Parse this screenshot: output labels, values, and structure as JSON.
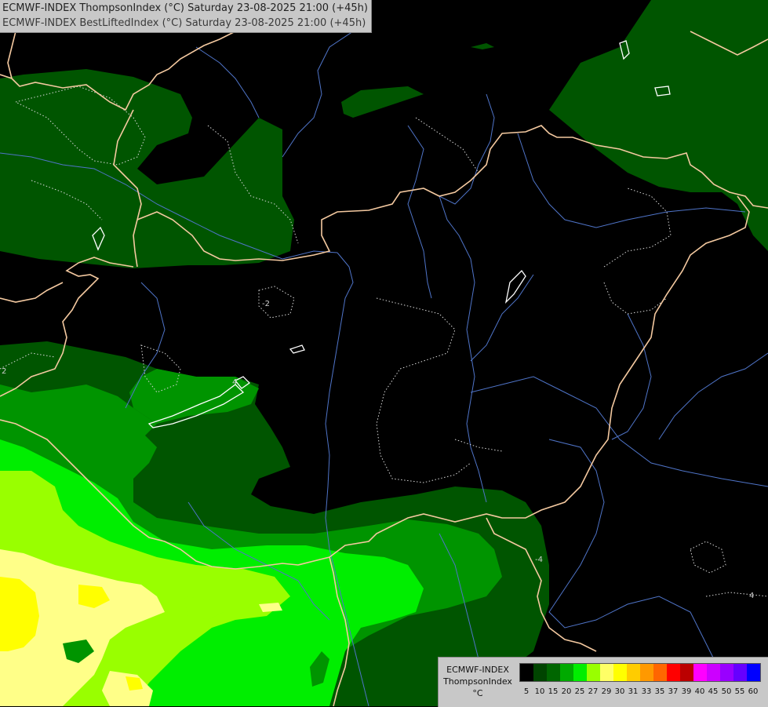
{
  "titles": {
    "line1": "ECMWF-INDEX ThompsonIndex (°C) Saturday 23-08-2025 21:00 (+45h)",
    "line2": "ECMWF-INDEX BestLiftedIndex (°C) Saturday 23-08-2025 21:00 (+45h)"
  },
  "legend": {
    "source": "ECMWF-INDEX",
    "parameter": "ThompsonIndex",
    "unit": "°C",
    "colors": [
      "#000000",
      "#000000",
      "#000000",
      "#000000",
      "#004400",
      "#006600",
      "#00aa00",
      "#00ee00",
      "#99ff00",
      "#ffff66",
      "#ffff00",
      "#ffcc00",
      "#ff9900",
      "#ff6600",
      "#ff0000",
      "#bb0000",
      "#ff00ff",
      "#cc00ff",
      "#9900ff",
      "#6600ff",
      "#0000ff"
    ],
    "tick_labels": [
      "5",
      "10",
      "15",
      "20",
      "25",
      "27",
      "29",
      "30",
      "31",
      "33",
      "35",
      "37",
      "39",
      "40",
      "45",
      "50",
      "55",
      "60"
    ]
  },
  "contour_labels": [
    "-2",
    "-4",
    "4",
    "4",
    "2"
  ],
  "map_colors": {
    "dark_green": "#005500",
    "mid_green": "#009400",
    "bright_green": "#00ee00",
    "lime": "#99ff00",
    "pale_yellow": "#ffff88",
    "yellow": "#ffff00",
    "border": "#f4c9a0",
    "river": "#4f74c8"
  }
}
